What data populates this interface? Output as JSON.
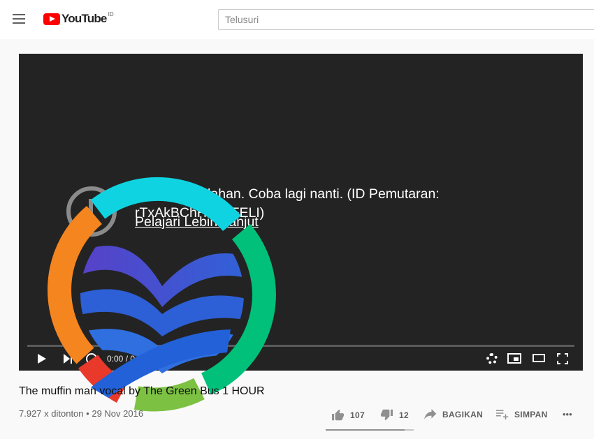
{
  "header": {
    "logo_text": "YouTube",
    "region": "ID",
    "search_placeholder": "Telusuri"
  },
  "player": {
    "error_message": "Terjadi kesalahan. Coba lagi nanti. (ID Pemutaran: rTxAkBChHaeBFELI)",
    "learn_more": "Pelajari Lebih Lanjut",
    "time": "0:00 / 0:00",
    "progress_fraction": 0
  },
  "video": {
    "title": "The muffin man vocal by The Green Bus 1 HOUR",
    "views": "7.927 x ditonton",
    "separator": "•",
    "date": "29 Nov 2016",
    "likes": "107",
    "dislikes": "12",
    "share_label": "BAGIKAN",
    "save_label": "SIMPAN",
    "more_label": "•••",
    "like_fraction": 0.9
  },
  "icons": {
    "menu": "hamburger-menu-icon",
    "like": "thumbs-up-icon",
    "dislike": "thumbs-down-icon",
    "share": "share-arrow-icon",
    "save": "playlist-add-icon"
  },
  "colors": {
    "brand_red": "#ff0000",
    "player_bg": "#232323"
  }
}
